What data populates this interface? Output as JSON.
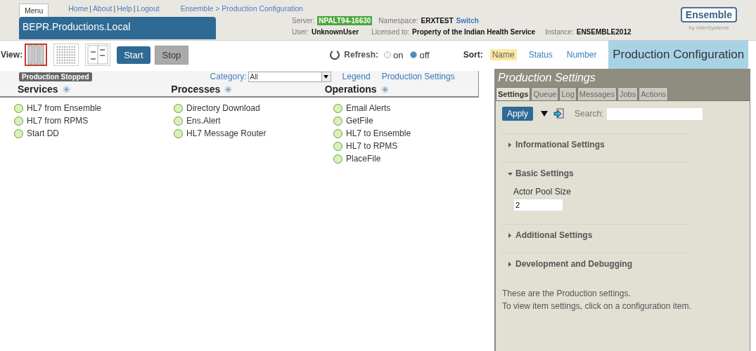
{
  "header": {
    "menu_tab": "Menu",
    "links": [
      "Home",
      "About",
      "Help",
      "Logout"
    ],
    "link_separator": "|",
    "breadcrumb": "Ensemble > Production Configuration",
    "production": "BEPR.Productions.Local",
    "server_label": "Server:",
    "server": "NPALT94-16630",
    "namespace_label": "Namespace:",
    "namespace": "ERXTEST",
    "switch": "Switch",
    "user_label": "User:",
    "user": "UnknownUser",
    "licensed_label": "Licensed to:",
    "licensed": "Property of the Indian Health Service",
    "instance_label": "Instance:",
    "instance": "ENSEMBLE2012",
    "logo": "Ensemble",
    "logo_sub": "by InterSystems"
  },
  "toolbar": {
    "view_label": "View:",
    "views": [
      {
        "kind": "columns",
        "selected": true
      },
      {
        "kind": "dots",
        "selected": false
      },
      {
        "kind": "split",
        "selected": false
      }
    ],
    "start": "Start",
    "stop": "Stop",
    "refresh_label": "Refresh:",
    "refresh_options": [
      {
        "label": "on",
        "selected": false
      },
      {
        "label": "off",
        "selected": true
      }
    ],
    "sort_label": "Sort:",
    "sort_options": [
      {
        "label": "Name",
        "selected": true
      },
      {
        "label": "Status",
        "selected": false
      },
      {
        "label": "Number",
        "selected": false
      }
    ],
    "page_title": "Production Configuration"
  },
  "diagram": {
    "status": "Production Stopped",
    "category_label": "Category:",
    "category": "All",
    "legend": "Legend",
    "settings_link": "Production Settings",
    "columns": [
      {
        "title": "Services",
        "items": [
          "HL7 from Ensemble",
          "HL7 from RPMS",
          "Start DD"
        ]
      },
      {
        "title": "Processes",
        "items": [
          "Directory Download",
          "Ens.Alert",
          "HL7 Message Router"
        ]
      },
      {
        "title": "Operations",
        "items": [
          "Email Alerts",
          "GetFile",
          "HL7 to Ensemble",
          "HL7 to RPMS",
          "PlaceFile"
        ]
      }
    ]
  },
  "panel": {
    "title": "Production Settings",
    "tabs": [
      {
        "label": "Settings",
        "selected": true
      },
      {
        "label": "Queue",
        "selected": false
      },
      {
        "label": "Log",
        "selected": false
      },
      {
        "label": "Messages",
        "selected": false
      },
      {
        "label": "Jobs",
        "selected": false
      },
      {
        "label": "Actions",
        "selected": false
      }
    ],
    "apply": "Apply",
    "search_label": "Search:",
    "sections": [
      {
        "title": "Informational Settings",
        "expanded": false
      },
      {
        "title": "Basic Settings",
        "expanded": true,
        "fields": [
          {
            "label": "Actor Pool Size",
            "value": "2"
          }
        ]
      },
      {
        "title": "Additional Settings",
        "expanded": false
      },
      {
        "title": "Development and Debugging",
        "expanded": false
      }
    ],
    "notes": [
      "These are the Production settings.",
      "To view item settings, click on a configuration item."
    ]
  }
}
